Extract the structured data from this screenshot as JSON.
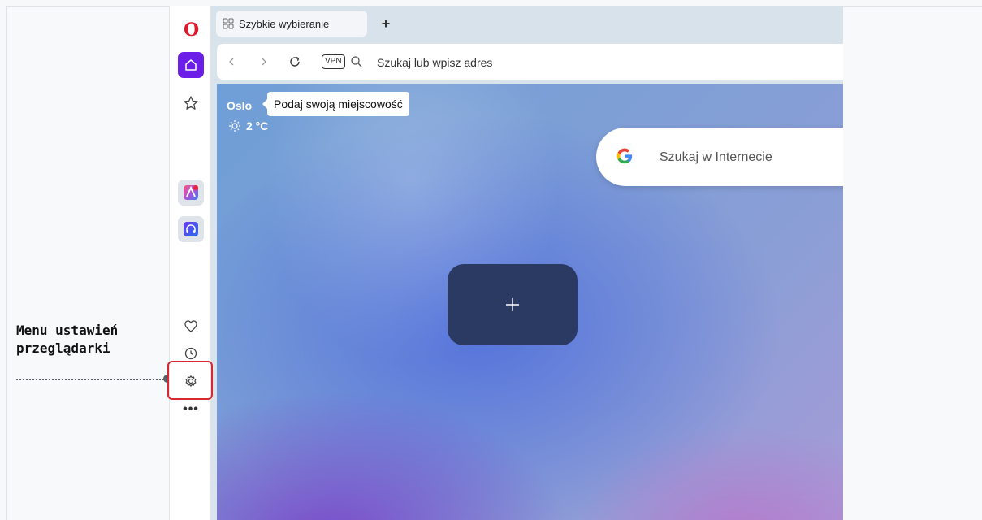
{
  "annotation": {
    "line1": "Menu ustawień",
    "line2": "przeglądarki",
    "highlight_color": "#d9282f"
  },
  "tabs": [
    {
      "label": "Szybkie wybieranie",
      "icon": "grid-icon"
    }
  ],
  "new_tab": "+",
  "addressbar": {
    "vpn_label": "VPN",
    "placeholder": "Szukaj lub wpisz adres"
  },
  "weather": {
    "city": "Oslo",
    "tooltip": "Podaj swoją miejscowość",
    "temperature": "2 °C",
    "icon": "sun-icon"
  },
  "google_search": {
    "placeholder": "Szukaj w Internecie"
  },
  "sidebar": {
    "items": [
      {
        "name": "opera-logo",
        "icon": "opera-logo-icon"
      },
      {
        "name": "home",
        "icon": "home-icon",
        "active": true
      },
      {
        "name": "bookmarks",
        "icon": "star-icon"
      },
      {
        "name": "aria",
        "icon": "aria-icon"
      },
      {
        "name": "music",
        "icon": "headphones-icon"
      },
      {
        "name": "favorites",
        "icon": "heart-icon"
      },
      {
        "name": "history",
        "icon": "clock-icon"
      },
      {
        "name": "settings",
        "icon": "gear-icon"
      },
      {
        "name": "more",
        "icon": "more-icon"
      }
    ],
    "accent_color": "#6a1ee8"
  },
  "colors": {
    "opera_red": "#e0182d",
    "tile_bg": "#2b3a63"
  }
}
